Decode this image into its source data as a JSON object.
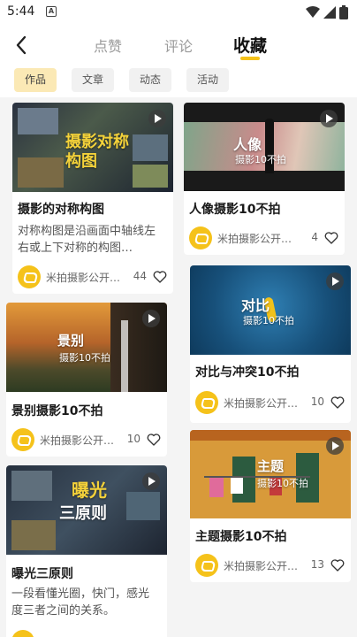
{
  "status": {
    "time": "5:44",
    "notif_letter": "A"
  },
  "tabs": [
    {
      "label": "点赞"
    },
    {
      "label": "评论"
    },
    {
      "label": "收藏"
    }
  ],
  "filters": [
    {
      "label": "作品",
      "active": true
    },
    {
      "label": "文章",
      "active": false
    },
    {
      "label": "动态",
      "active": false
    },
    {
      "label": "活动",
      "active": false
    }
  ],
  "cards": [
    {
      "title": "摄影的对称构图",
      "overlay": "摄影对称构图",
      "overlay_sub": "",
      "desc": "对称构图是沿画面中轴线左右或上下对称的构图…",
      "author": "米拍摄影公开…",
      "likes": "44"
    },
    {
      "title": "人像摄影10不拍",
      "overlay": "人像",
      "overlay_sub": "摄影10不拍",
      "desc": "",
      "author": "米拍摄影公开…",
      "likes": "4"
    },
    {
      "title": "对比与冲突10不拍",
      "overlay": "对比",
      "overlay_sub": "摄影10不拍",
      "desc": "",
      "author": "米拍摄影公开…",
      "likes": "10"
    },
    {
      "title": "景别摄影10不拍",
      "overlay": "景别",
      "overlay_sub": "摄影10不拍",
      "desc": "",
      "author": "米拍摄影公开…",
      "likes": "10"
    },
    {
      "title": "主题摄影10不拍",
      "overlay": "主题",
      "overlay_sub": "摄影10不拍",
      "desc": "",
      "author": "米拍摄影公开…",
      "likes": "13"
    },
    {
      "title": "曝光三原则",
      "overlay": "曝光",
      "overlay_sub": "三原则",
      "desc": "一段看懂光圈，快门，感光度三者之间的关系。",
      "author": "",
      "likes": ""
    }
  ],
  "colors": {
    "accent": "#f5c21a",
    "chip_active": "#fbe9b5"
  }
}
